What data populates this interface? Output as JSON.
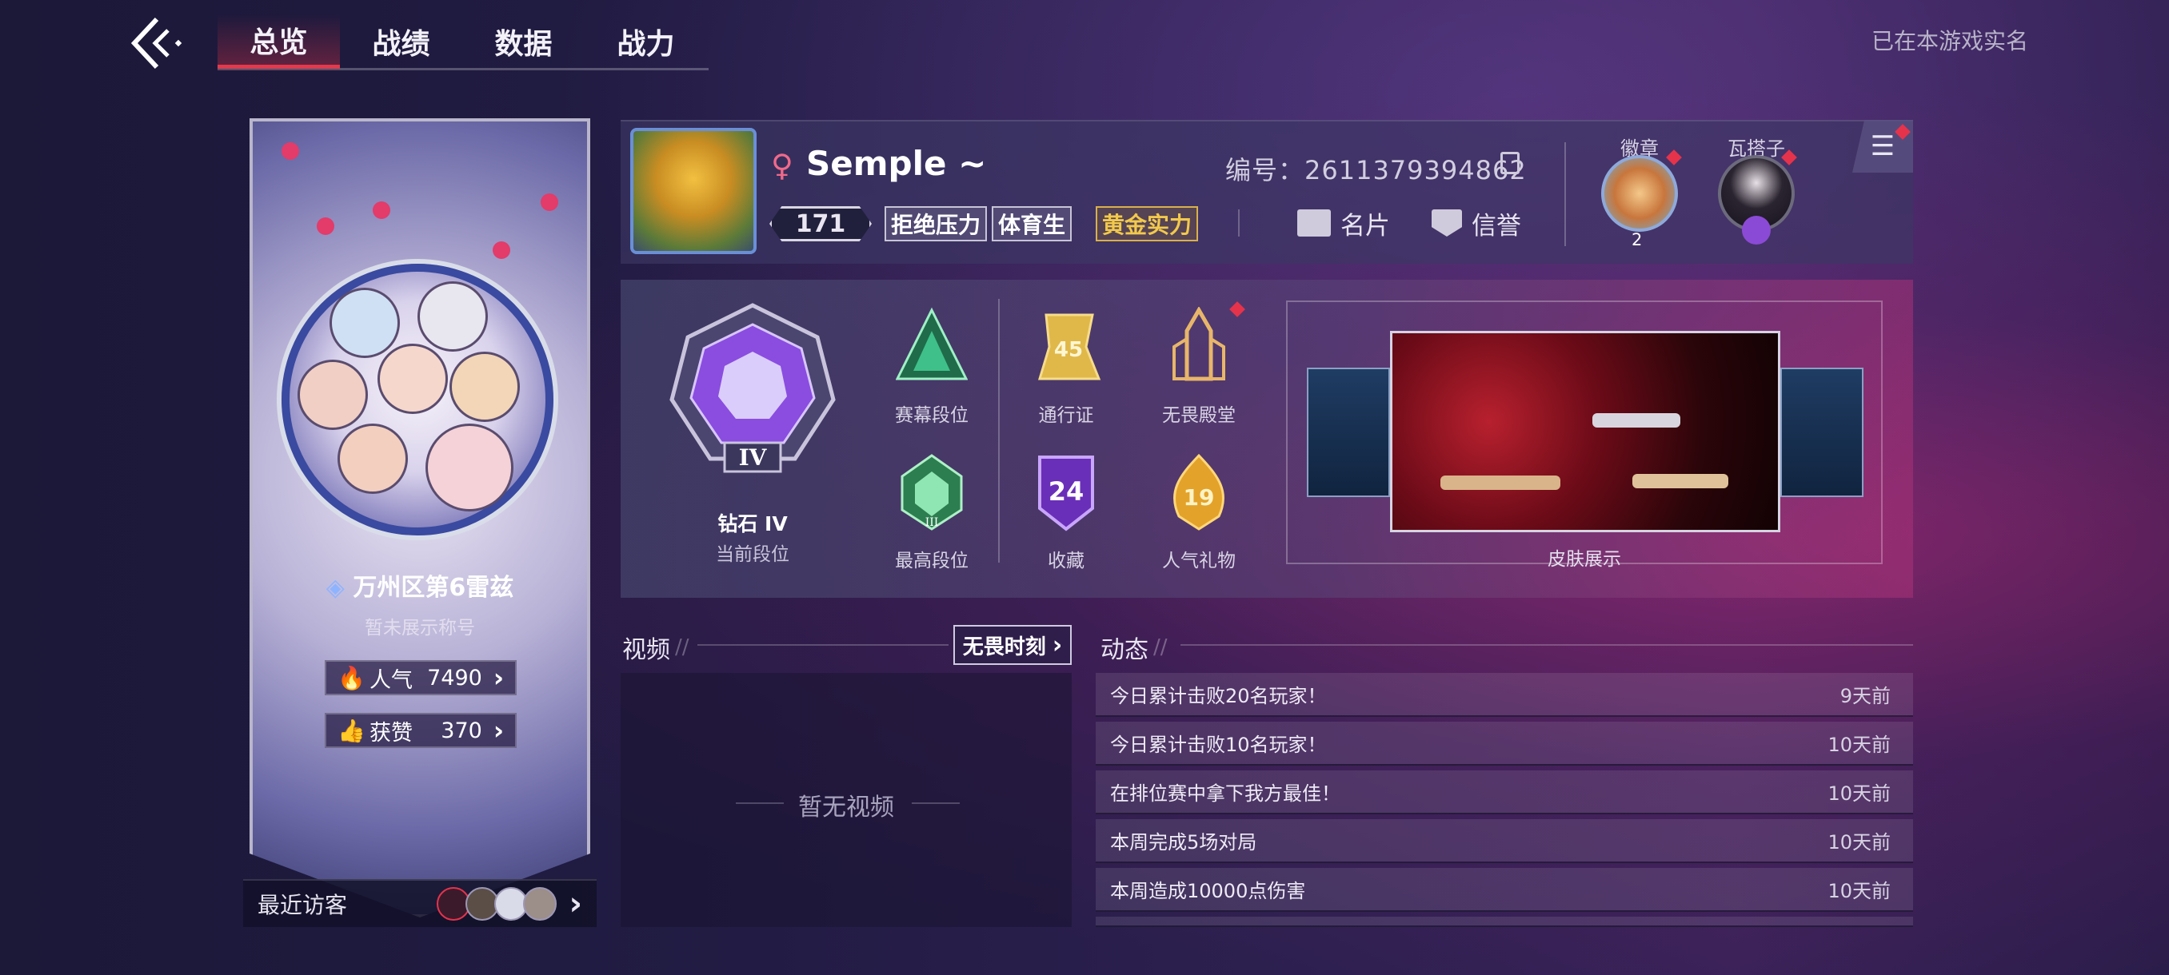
{
  "nav": {
    "tabs": [
      {
        "label": "总览",
        "active": true
      },
      {
        "label": "战绩",
        "active": false
      },
      {
        "label": "数据",
        "active": false
      },
      {
        "label": "战力",
        "active": false
      }
    ],
    "realname_text": "已在本游戏实名"
  },
  "banner": {
    "title": "万州区第6雷兹",
    "subtitle": "暂未展示称号",
    "popularity_label": "人气",
    "popularity_value": "7490",
    "likes_label": "获赞",
    "likes_value": "370",
    "visitors_label": "最近访客"
  },
  "profile": {
    "username": "Semple ~",
    "level": "171",
    "tags": [
      "拒绝压力",
      "体育生",
      "黄金实力"
    ],
    "id_text": "编号：2611379394862",
    "card_label": "名片",
    "credit_label": "信誉",
    "badge_label": "徽章",
    "badge_count": "2",
    "partner_label": "瓦搭子"
  },
  "ranks": {
    "current_rank_name": "钻石 IV",
    "current_rank_label": "当前段位",
    "rank_roman": "IV",
    "season_rank_label": "赛幕段位",
    "highest_rank_label": "最高段位",
    "highest_roman": "III",
    "pass_label": "通行证",
    "pass_value": "45",
    "hall_label": "无畏殿堂",
    "collection_label": "收藏",
    "collection_value": "24",
    "gift_label": "人气礼物",
    "gift_value": "19",
    "skin_label": "皮肤展示"
  },
  "video": {
    "title": "视频",
    "moment_button": "无畏时刻",
    "empty_text": "暂无视频"
  },
  "feed": {
    "title": "动态",
    "items": [
      {
        "text": "今日累计击败20名玩家！",
        "time": "9天前"
      },
      {
        "text": "今日累计击败10名玩家！",
        "time": "10天前"
      },
      {
        "text": "在排位赛中拿下我方最佳！",
        "time": "10天前"
      },
      {
        "text": "本周完成5场对局",
        "time": "10天前"
      },
      {
        "text": "本周造成10000点伤害",
        "time": "10天前"
      }
    ]
  },
  "colors": {
    "accent_red": "#e23a4c",
    "gold": "#f2c94c",
    "background": "#221c44"
  }
}
